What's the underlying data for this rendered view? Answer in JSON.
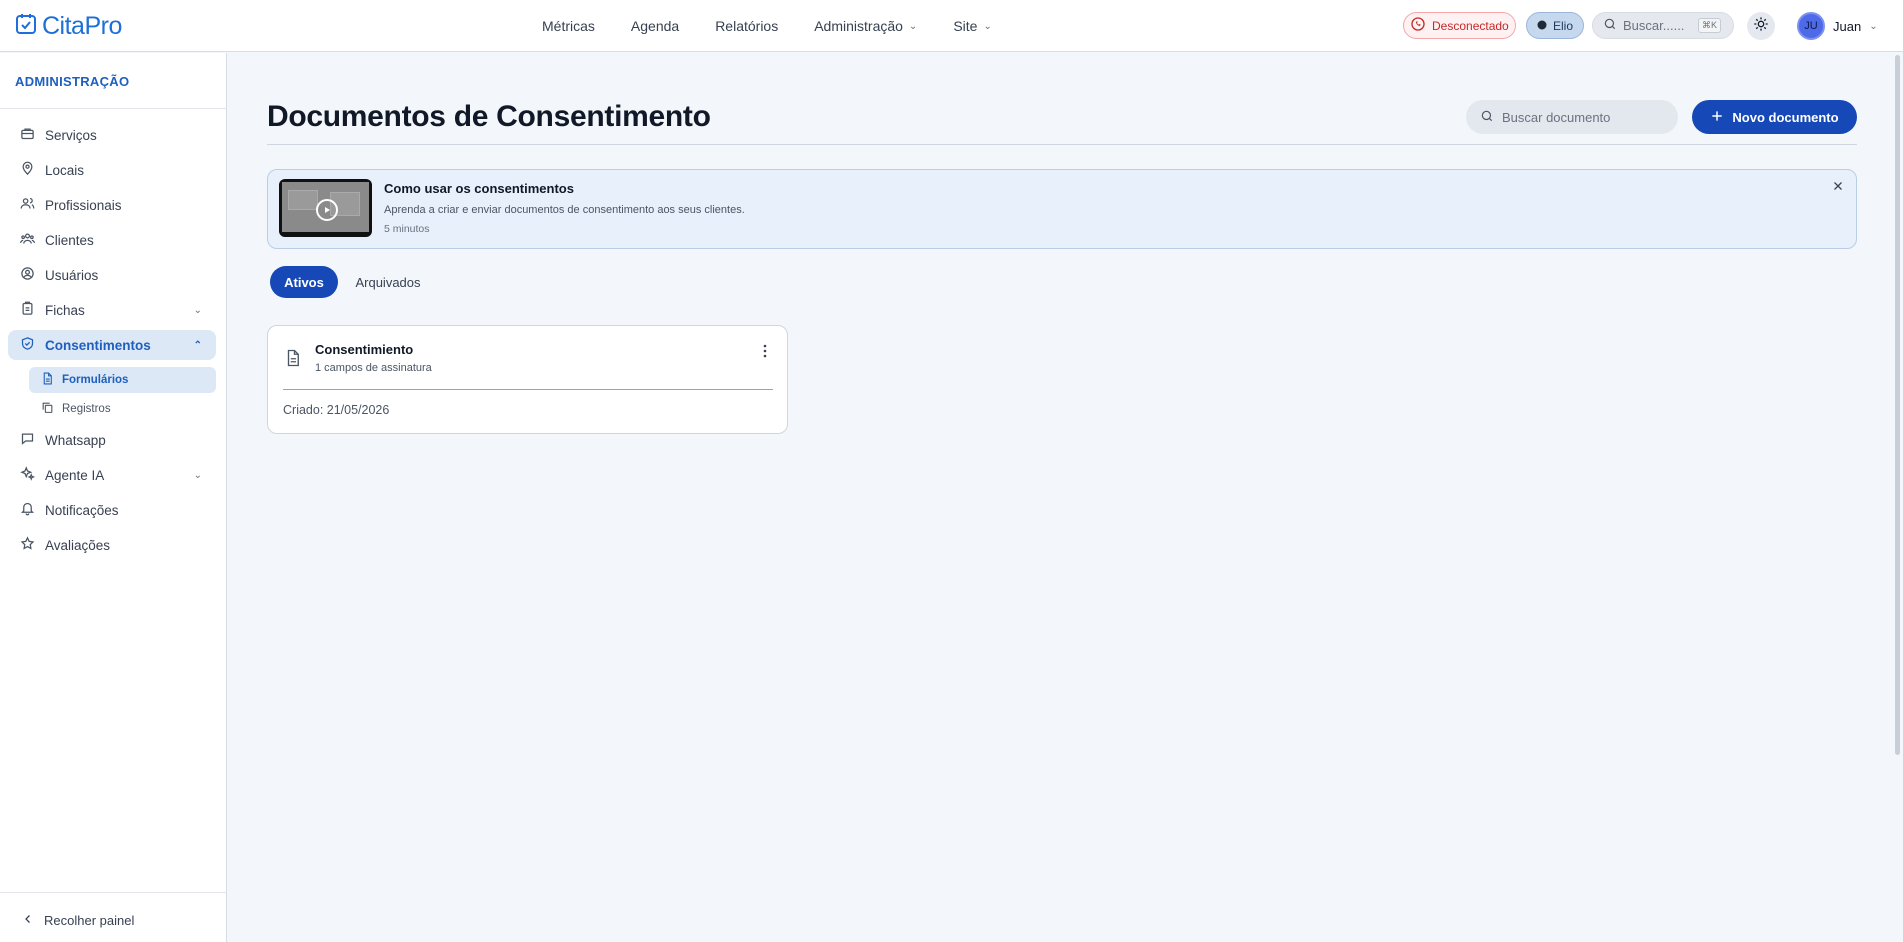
{
  "app": {
    "name": "CitaPro"
  },
  "nav": [
    {
      "label": "Métricas",
      "dropdown": false
    },
    {
      "label": "Agenda",
      "dropdown": false
    },
    {
      "label": "Relatórios",
      "dropdown": false
    },
    {
      "label": "Administração",
      "dropdown": true
    },
    {
      "label": "Site",
      "dropdown": true
    }
  ],
  "header": {
    "whatsapp_status": "Desconectado",
    "assistant_label": "Elio",
    "search_placeholder": "Buscar......",
    "search_shortcut": "⌘K",
    "user_initials": "JU",
    "user_name": "Juan"
  },
  "sidebar": {
    "title": "ADMINISTRAÇÃO",
    "items": [
      {
        "label": "Serviços",
        "icon": "briefcase-icon"
      },
      {
        "label": "Locais",
        "icon": "map-pin-icon"
      },
      {
        "label": "Profissionais",
        "icon": "users-icon"
      },
      {
        "label": "Clientes",
        "icon": "user-group-icon"
      },
      {
        "label": "Usuários",
        "icon": "user-circle-icon"
      },
      {
        "label": "Fichas",
        "icon": "clipboard-icon"
      },
      {
        "label": "Consentimentos",
        "icon": "shield-check-icon"
      },
      {
        "label": "Whatsapp",
        "icon": "chat-icon"
      },
      {
        "label": "Agente IA",
        "icon": "sparkles-icon"
      },
      {
        "label": "Notificações",
        "icon": "bell-icon"
      },
      {
        "label": "Avaliações",
        "icon": "star-icon"
      }
    ],
    "subitems": [
      {
        "label": "Formulários",
        "icon": "document-icon"
      },
      {
        "label": "Registros",
        "icon": "copy-icon"
      }
    ],
    "collapse_label": "Recolher painel"
  },
  "main": {
    "title": "Documentos de Consentimento",
    "search_placeholder": "Buscar documento",
    "new_button": "Novo documento",
    "banner": {
      "title": "Como usar os consentimentos",
      "description": "Aprenda a criar e enviar documentos de consentimento aos seus clientes.",
      "duration": "5 minutos"
    },
    "tabs": [
      {
        "label": "Ativos",
        "active": true
      },
      {
        "label": "Arquivados",
        "active": false
      }
    ],
    "documents": [
      {
        "title": "Consentimiento",
        "subtitle": "1 campos de assinatura",
        "created": "Criado: 21/05/2026"
      }
    ]
  },
  "colors": {
    "brand": "#1e6fd9",
    "primary_button": "#1648b8",
    "active_nav_bg": "#dce8f5",
    "danger": "#c62828"
  }
}
